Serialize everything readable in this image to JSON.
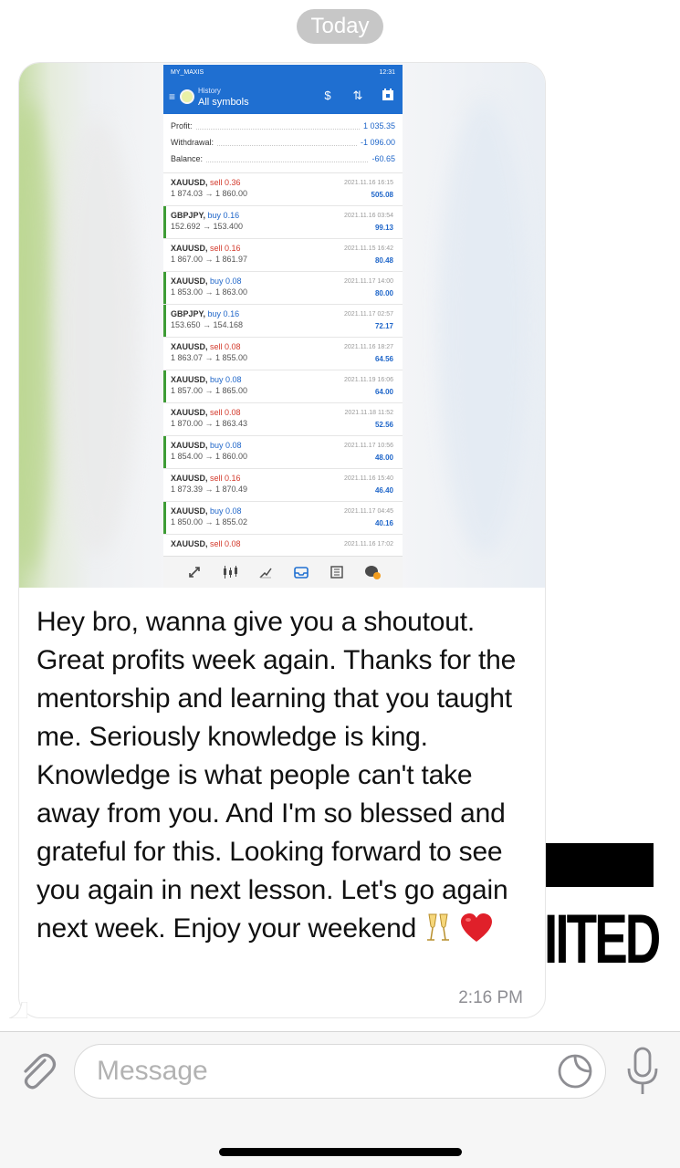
{
  "chat": {
    "date_label": "Today",
    "background_overlay_text": "IITED"
  },
  "screenshot": {
    "status_left": "MY_MAXIS",
    "status_time": "12:31",
    "app_title": "History",
    "app_subtitle": "All symbols",
    "summary": [
      {
        "label": "Profit:",
        "value": "1 035.35"
      },
      {
        "label": "Withdrawal:",
        "value": "-1 096.00"
      },
      {
        "label": "Balance:",
        "value": "-60.65"
      }
    ],
    "trades": [
      {
        "symbol": "XAUUSD,",
        "side": "sell 0.36",
        "dir": "sell",
        "price": "1 874.03 → 1 860.00",
        "date": "2021.11.16 16:15",
        "profit": "505.08"
      },
      {
        "symbol": "GBPJPY,",
        "side": "buy 0.16",
        "dir": "buy",
        "price": "152.692 → 153.400",
        "date": "2021.11.16 03:54",
        "profit": "99.13"
      },
      {
        "symbol": "XAUUSD,",
        "side": "sell 0.16",
        "dir": "sell",
        "price": "1 867.00 → 1 861.97",
        "date": "2021.11.15 16:42",
        "profit": "80.48"
      },
      {
        "symbol": "XAUUSD,",
        "side": "buy 0.08",
        "dir": "buy",
        "price": "1 853.00 → 1 863.00",
        "date": "2021.11.17 14:00",
        "profit": "80.00"
      },
      {
        "symbol": "GBPJPY,",
        "side": "buy 0.16",
        "dir": "buy",
        "price": "153.650 → 154.168",
        "date": "2021.11.17 02:57",
        "profit": "72.17"
      },
      {
        "symbol": "XAUUSD,",
        "side": "sell 0.08",
        "dir": "sell",
        "price": "1 863.07 → 1 855.00",
        "date": "2021.11.16 18:27",
        "profit": "64.56"
      },
      {
        "symbol": "XAUUSD,",
        "side": "buy 0.08",
        "dir": "buy",
        "price": "1 857.00 → 1 865.00",
        "date": "2021.11.19 16:06",
        "profit": "64.00"
      },
      {
        "symbol": "XAUUSD,",
        "side": "sell 0.08",
        "dir": "sell",
        "price": "1 870.00 → 1 863.43",
        "date": "2021.11.18 11:52",
        "profit": "52.56"
      },
      {
        "symbol": "XAUUSD,",
        "side": "buy 0.08",
        "dir": "buy",
        "price": "1 854.00 → 1 860.00",
        "date": "2021.11.17 10:56",
        "profit": "48.00"
      },
      {
        "symbol": "XAUUSD,",
        "side": "sell 0.16",
        "dir": "sell",
        "price": "1 873.39 → 1 870.49",
        "date": "2021.11.16 15:40",
        "profit": "46.40"
      },
      {
        "symbol": "XAUUSD,",
        "side": "buy 0.08",
        "dir": "buy",
        "price": "1 850.00 → 1 855.02",
        "date": "2021.11.17 04:45",
        "profit": "40.16"
      },
      {
        "symbol": "XAUUSD,",
        "side": "sell 0.08",
        "dir": "sell",
        "price": "",
        "date": "2021.11.16 17:02",
        "profit": ""
      }
    ],
    "nav_icons": [
      "quotes-icon",
      "chart-icon",
      "trade-icon",
      "history-icon",
      "news-icon",
      "messages-icon"
    ],
    "colors": {
      "app_blue": "#1f6fd1",
      "sell_red": "#d33a2c",
      "buy_blue": "#1f66c9",
      "edge_green": "#3e9c35"
    }
  },
  "message": {
    "text": "Hey bro, wanna give you a shoutout. Great profits week again. Thanks for the mentorship and learning that you taught me. Seriously knowledge is king. Knowledge is what people can't take away from you. And I'm so blessed and grateful for this. Looking forward to see you again in next lesson. Let's go again next week. Enjoy your weekend",
    "emojis": [
      "champagne-glasses-icon",
      "red-heart-icon"
    ],
    "time": "2:16 PM"
  },
  "composer": {
    "placeholder": "Message",
    "icons": [
      "paperclip-icon",
      "sticker-icon",
      "microphone-icon"
    ]
  }
}
